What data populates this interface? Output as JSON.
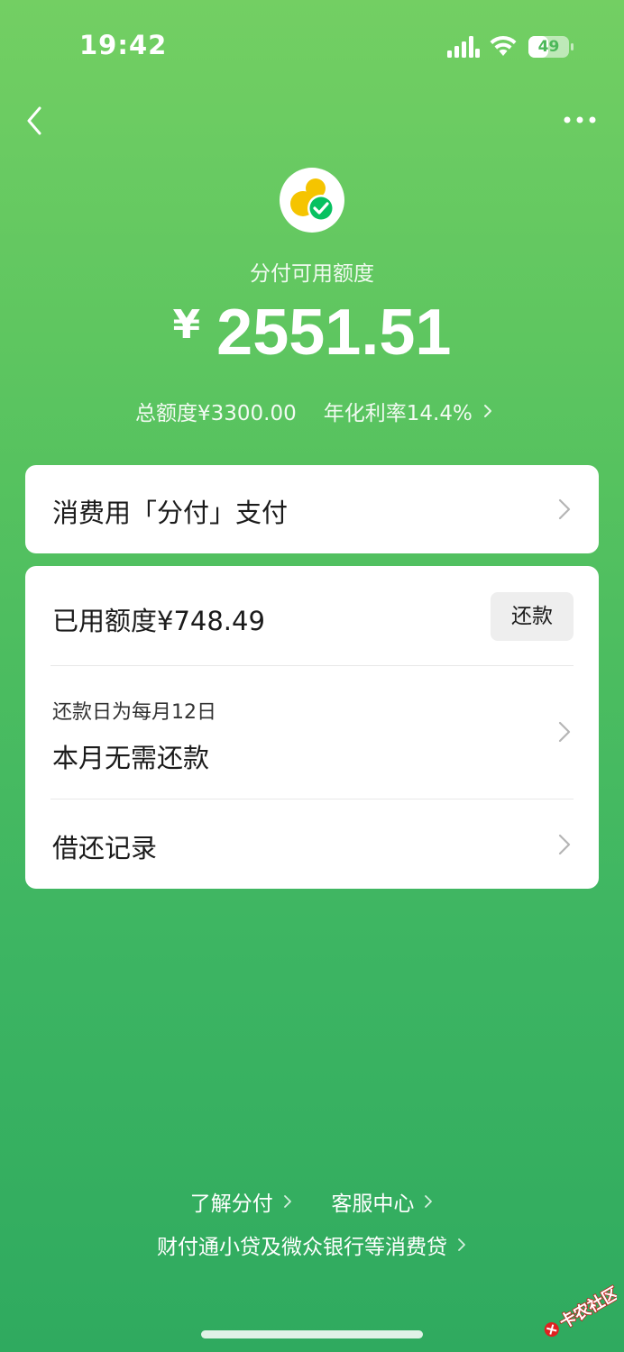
{
  "status_bar": {
    "time": "19:42",
    "battery": "49"
  },
  "header": {
    "back_icon": "chevron-left-icon",
    "more_icon": "more-dots-icon"
  },
  "summary": {
    "label": "分付可用额度",
    "currency": "¥",
    "available_amount": "2551.51",
    "total_limit": "总额度¥3300.00",
    "annual_rate": "年化利率14.4%"
  },
  "pay_card": {
    "label": "消费用「分付」支付"
  },
  "usage_card": {
    "used_label": "已用额度¥748.49",
    "repay_button": "还款",
    "due_day_label": "还款日为每月12日",
    "due_status": "本月无需还款",
    "history_label": "借还记录"
  },
  "footer": {
    "learn_link": "了解分付",
    "service_link": "客服中心",
    "loan_link": "财付通小贷及微众银行等消费贷"
  },
  "watermark": {
    "text": "卡农社区"
  },
  "colors": {
    "accent_green": "#4cbe5e",
    "card_bg": "#ffffff",
    "logo_yellow": "#f5c400",
    "check_green": "#07c160"
  }
}
